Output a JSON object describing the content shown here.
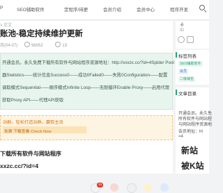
{
  "nav": {
    "logo_fragment": "P",
    "items": [
      "SEO辅助软件",
      "定程序/待更",
      "会员介绍",
      "会员中心",
      "程序开发"
    ]
  },
  "breadcrumb": "> 正文",
  "article": {
    "title": "账池-稳定持续维护更新",
    "date": "月(04-07)",
    "views": "96052",
    "comments": "13"
  },
  "notice": {
    "lines": [
      "开通会员。永久免费下载所有软件与网站程序资源地址：http://xxxzc.cc/?id=4Spider Pool",
      "器Statistics——统计信息Success0——成功0Failed0——失败0Configuration——配置",
      "调取模式Sequential——顺序模式Infinite Loop——无限循环Enable Proxy——启用代理",
      "获取Proxy API——代理API获取"
    ]
  },
  "cta": {
    "line1": "站群。轻松打造站群，赢取主流",
    "bar": "免费 下载查看 Check Now"
  },
  "section_heading": "下载所有软件与网站程序",
  "url_text": "xxzc.cc/?id=4",
  "actions": {
    "badge_count": "13"
  },
  "sidebar": {
    "user_name": "卡",
    "user_sub": "ID",
    "tags_heading": "标签列表",
    "tags": [
      {
        "label": "SEO辅助软件",
        "color": "#e9f6ef",
        "text": "#27a17b"
      },
      {
        "label": "会员",
        "color": "#eaf2fd",
        "text": "#3b7dd8"
      },
      {
        "label": "二级域名",
        "color": "#e9f6ef",
        "text": "#27a17b"
      }
    ],
    "toc_heading": "文章目录",
    "toc_lines": [
      "开通会员。永久免",
      "所有软件与网站程",
      "与网站程序资源地",
      "",
      "会员地址：ht",
      "=4"
    ],
    "toc_big": [
      "新站",
      "被K站"
    ]
  }
}
